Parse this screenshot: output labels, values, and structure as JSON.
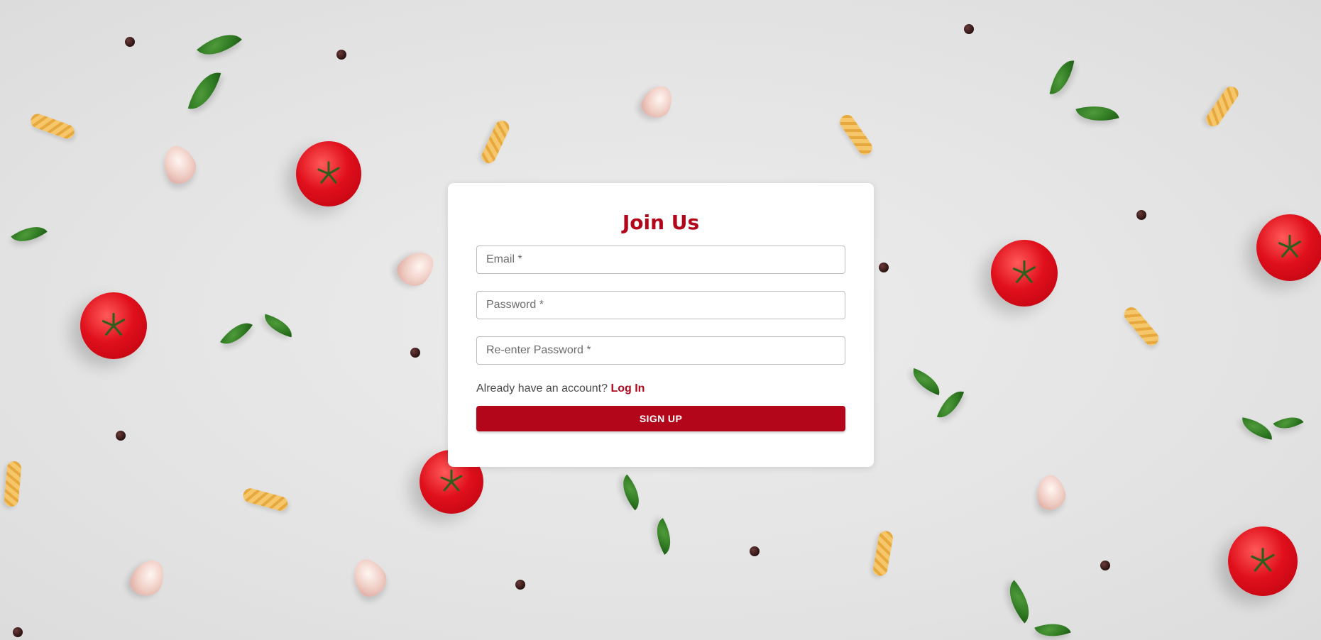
{
  "form": {
    "title": "Join Us",
    "email_placeholder": "Email *",
    "password_placeholder": "Password *",
    "reenter_password_placeholder": "Re-enter Password *",
    "login_prompt": "Already have an account?",
    "login_link": "Log In",
    "signup_label": "SIGN UP"
  },
  "colors": {
    "accent": "#b3061a",
    "background": "#e4e4e4",
    "card": "#ffffff"
  }
}
